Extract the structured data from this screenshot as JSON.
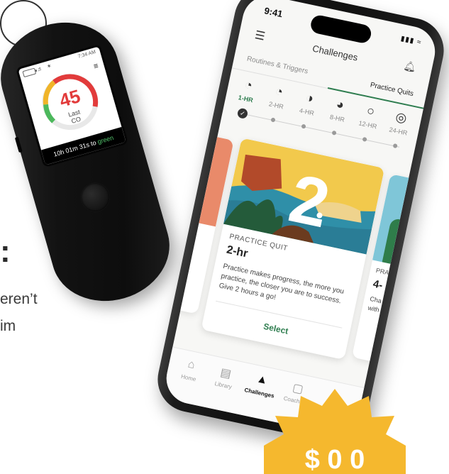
{
  "edge_text": {
    "colon": ":",
    "line1": "eren’t",
    "line2": "im"
  },
  "device": {
    "time": "7:34 AM",
    "value": "45",
    "label_line1": "Last",
    "label_line2": "CO",
    "footer_prefix": "10h 01m 31s to ",
    "footer_highlight": "green",
    "gauge_colors": [
      "#4cb85c",
      "#f0b429",
      "#e23b3b"
    ]
  },
  "phone": {
    "status_time": "9:41",
    "app_title": "Challenges",
    "tabs": [
      {
        "label": "Routines & Triggers",
        "active": false
      },
      {
        "label": "Practice Quits",
        "active": true
      }
    ],
    "durations": [
      {
        "label": "1-HR",
        "icon": "◔",
        "active": true
      },
      {
        "label": "2-HR",
        "icon": "◔",
        "active": false
      },
      {
        "label": "4-HR",
        "icon": "◑",
        "active": false
      },
      {
        "label": "8-HR",
        "icon": "◕",
        "active": false
      },
      {
        "label": "12-HR",
        "icon": "○",
        "active": false
      },
      {
        "label": "24-HR",
        "icon": "◎",
        "active": false
      }
    ],
    "card": {
      "big_number": "2",
      "kicker": "PRACTICE QUIT",
      "title": "2-hr",
      "description": "Practice makes progress, the more you practice, the closer you are to success. Give 2 hours a go!",
      "action": "Select"
    },
    "next_card": {
      "kicker": "PRA",
      "title": "4-",
      "description": "Cha bloc with"
    },
    "nav": [
      {
        "label": "Home",
        "icon": "⌂",
        "active": false
      },
      {
        "label": "Library",
        "icon": "▤",
        "active": false
      },
      {
        "label": "Challenges",
        "icon": "▲",
        "active": true
      },
      {
        "label": "Coaching",
        "icon": "▢",
        "active": false
      }
    ],
    "accent_color": "#2e7d4f"
  },
  "badge": {
    "text": "$ 0 0",
    "color": "#f5b82e"
  }
}
